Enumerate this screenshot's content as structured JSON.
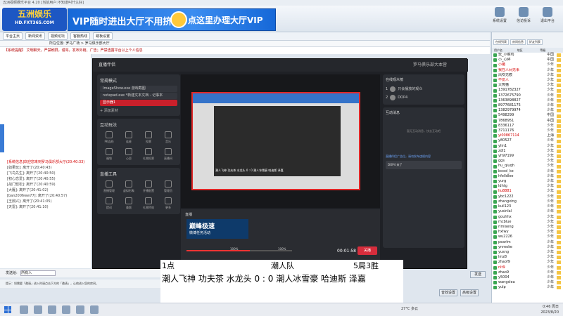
{
  "window": {
    "title": "五洲视频娱乐平台 4.20 [当前用户:不知道叫什么好]"
  },
  "banner": {
    "logo_main": "五洲娱乐",
    "logo_sub": "HD.FXT365.COM",
    "ad_left": "VIP随时进出大厅不用挤",
    "ad_right": "点这里办理大厅VIP",
    "buttons": [
      "系统设置",
      "信访投诉",
      "退出平台"
    ]
  },
  "toolbar": {
    "items": [
      "平台主页",
      "新闻资讯",
      "视频论坛",
      "客服热线",
      "跳板设置"
    ]
  },
  "breadcrumb": "所在位置: 罗马广场 > 罗马俱乐部大厅",
  "notice": "【系统提醒】 文明聊天，严禁刷屏，谩骂，发布外链、广告；严禁透露平台以上个人信息",
  "chat": {
    "lines": [
      {
        "text": "[系统信息]欢迎您来到罗马俱乐部大厅(20:40:33)",
        "sys": true
      },
      {
        "text": "[如果玩]: 离开了(20:40:43)"
      },
      {
        "text": "[飞鸟先生]: 离开了(20:40:50)"
      },
      {
        "text": "[初心恋爱]: 离开了(20:40:55)"
      },
      {
        "text": "[战门轻松]: 离开了(20:40:59)"
      },
      {
        "text": "[大雁]: 离开了(20:41:02)"
      },
      {
        "text": "[ban2006ww77]: 离开了(20:40:57)"
      },
      {
        "text": "[王鼎兴]: 离开了(20:41:05)"
      },
      {
        "text": "[天雷]: 离开了(20:41:10)"
      }
    ]
  },
  "stream": {
    "title": "直播伴侣",
    "header_right": "罗马俱乐部大本营",
    "scene_label": "常规模式",
    "sources": [
      {
        "label": "ImageShow.exe 游戏截图",
        "selected": false
      },
      {
        "label": "notepad.exe *新建文本文档 - 记事本",
        "selected": false
      },
      {
        "label": "显示器1",
        "selected": true
      }
    ],
    "add_source": "+ 添加素材",
    "interact_title": "互动玩法",
    "interact_items": [
      "PK连线",
      "连麦",
      "投票",
      "音乐",
      "福袋",
      "心愿",
      "礼物投票",
      "直播间"
    ],
    "tools_title": "直播工具",
    "tool_items": [
      "直播管理",
      "虚拟形象",
      "开播配置",
      "管理员",
      "提词",
      "美颜",
      "礼物特效",
      "更多"
    ],
    "live_title": "直播",
    "speed_title": "巅峰极速",
    "speed_sub": "微博任务活动",
    "vol1": "100%",
    "vol2": "100%",
    "timer": "00:01:58",
    "golive_label": "关播",
    "statusbar": "CPU 44%  内存 14%  GPU 41%  帧率 60  码率 6213kbps",
    "caption": "潮人飞神  功夫茶  水龙头 0 : 0  潮人冰雪豪  哈迪斯  泽嘉",
    "ranking_title": "在线观众榜",
    "ranking": [
      {
        "rank": "1",
        "name": "只会播放的观众"
      },
      {
        "rank": "2",
        "name": "DOP4"
      }
    ],
    "chat_title": "互动消息",
    "chat_empty": "暂无互动消息，快去互动吧",
    "sys_msg": "直播伴侣广告位，请勿发布违规内容",
    "user_msg": "DOP4 来了"
  },
  "score": {
    "left": "1点",
    "team": "潮人队",
    "result": "5局3胜",
    "line": "潮人飞神  功夫茶  水龙头  0 : 0  潮人冰雪豪  哈迪斯  泽嘉"
  },
  "input": {
    "label": "发送给:",
    "value": "所有人"
  },
  "send_label": "发送",
  "tips": "提示：如需要「邀请」进入时请点击下方的「邀请」，让他进入您的房间。",
  "footer_buttons": [
    "音效设置",
    "高级设置"
  ],
  "userlist": {
    "tabs": [
      "在线列表",
      "房间信息",
      "好友列表"
    ],
    "columns": [
      "用户名",
      "地区",
      "等级"
    ],
    "rows": [
      {
        "name": "玩_小菜鸡",
        "area": "中国",
        "red": false
      },
      {
        "name": "小_心碎",
        "area": "中国",
        "red": false
      },
      {
        "name": "小猪",
        "area": "少年",
        "red": true
      },
      {
        "name": "我在人间无事",
        "area": "少年",
        "red": true
      },
      {
        "name": "风吹无痕",
        "area": "少年",
        "red": false
      },
      {
        "name": "不爱人",
        "area": "少年",
        "red": true
      },
      {
        "name": "大熊猫",
        "area": "少年",
        "red": false
      },
      {
        "name": "1391782327",
        "area": "少年",
        "red": false
      },
      {
        "name": "1372675790",
        "area": "少年",
        "red": false
      },
      {
        "name": "1363898827",
        "area": "少年",
        "red": false
      },
      {
        "name": "8977681175",
        "area": "少年",
        "red": false
      },
      {
        "name": "1382979974",
        "area": "少年",
        "red": false
      },
      {
        "name": "5498299",
        "area": "中国",
        "red": false
      },
      {
        "name": "7868951",
        "area": "中国",
        "red": false
      },
      {
        "name": "8336117",
        "area": "少年",
        "red": false
      },
      {
        "name": "3711176",
        "area": "少年",
        "red": false
      },
      {
        "name": "yi00867114",
        "area": "上海",
        "red": true
      },
      {
        "name": "y80527",
        "area": "少年",
        "red": false
      },
      {
        "name": "ylin1",
        "area": "少年",
        "red": false
      },
      {
        "name": "zdl1",
        "area": "少年",
        "red": false
      },
      {
        "name": "yh97199",
        "area": "少年",
        "red": false
      },
      {
        "name": "ggs",
        "area": "少年",
        "red": false
      },
      {
        "name": "hu_qiuqh",
        "area": "少年",
        "red": false
      },
      {
        "name": "bcool_ke",
        "area": "少年",
        "red": false
      },
      {
        "name": "hfelldlee",
        "area": "少年",
        "red": false
      },
      {
        "name": "yurg",
        "area": "少年",
        "red": false
      },
      {
        "name": "ldhtg",
        "area": "少年",
        "red": false
      },
      {
        "name": "liu8881",
        "area": "少年",
        "red": true
      },
      {
        "name": "ybc1222",
        "area": "少年",
        "red": false
      },
      {
        "name": "zhangxing",
        "area": "少年",
        "red": false
      },
      {
        "name": "kuil123",
        "area": "少年",
        "red": false
      },
      {
        "name": "yusinlal",
        "area": "少年",
        "red": false
      },
      {
        "name": "gouhhx",
        "area": "少年",
        "red": false
      },
      {
        "name": "mcblue",
        "area": "少年",
        "red": false
      },
      {
        "name": "rlmiseng",
        "area": "少年",
        "red": false
      },
      {
        "name": "hxlwy",
        "area": "少年",
        "red": false
      },
      {
        "name": "wu2226",
        "area": "少年",
        "red": false
      },
      {
        "name": "pearlm",
        "area": "少年",
        "red": false
      },
      {
        "name": "ynreoke",
        "area": "少年",
        "red": false
      },
      {
        "name": "yusng",
        "area": "少年",
        "red": false
      },
      {
        "name": "lmz8",
        "area": "少年",
        "red": false
      },
      {
        "name": "zhaof9",
        "area": "少年",
        "red": false
      },
      {
        "name": "nlt9",
        "area": "少年",
        "red": true
      },
      {
        "name": "zhao9",
        "area": "少年",
        "red": false
      },
      {
        "name": "y5004",
        "area": "少年",
        "red": false
      },
      {
        "name": "wangslea",
        "area": "少年",
        "red": false
      },
      {
        "name": "yulp",
        "area": "少年",
        "red": false
      }
    ]
  },
  "taskbar": {
    "weather": "27°C 多云",
    "time": "0:46 周日",
    "date": "2023/8/20"
  }
}
